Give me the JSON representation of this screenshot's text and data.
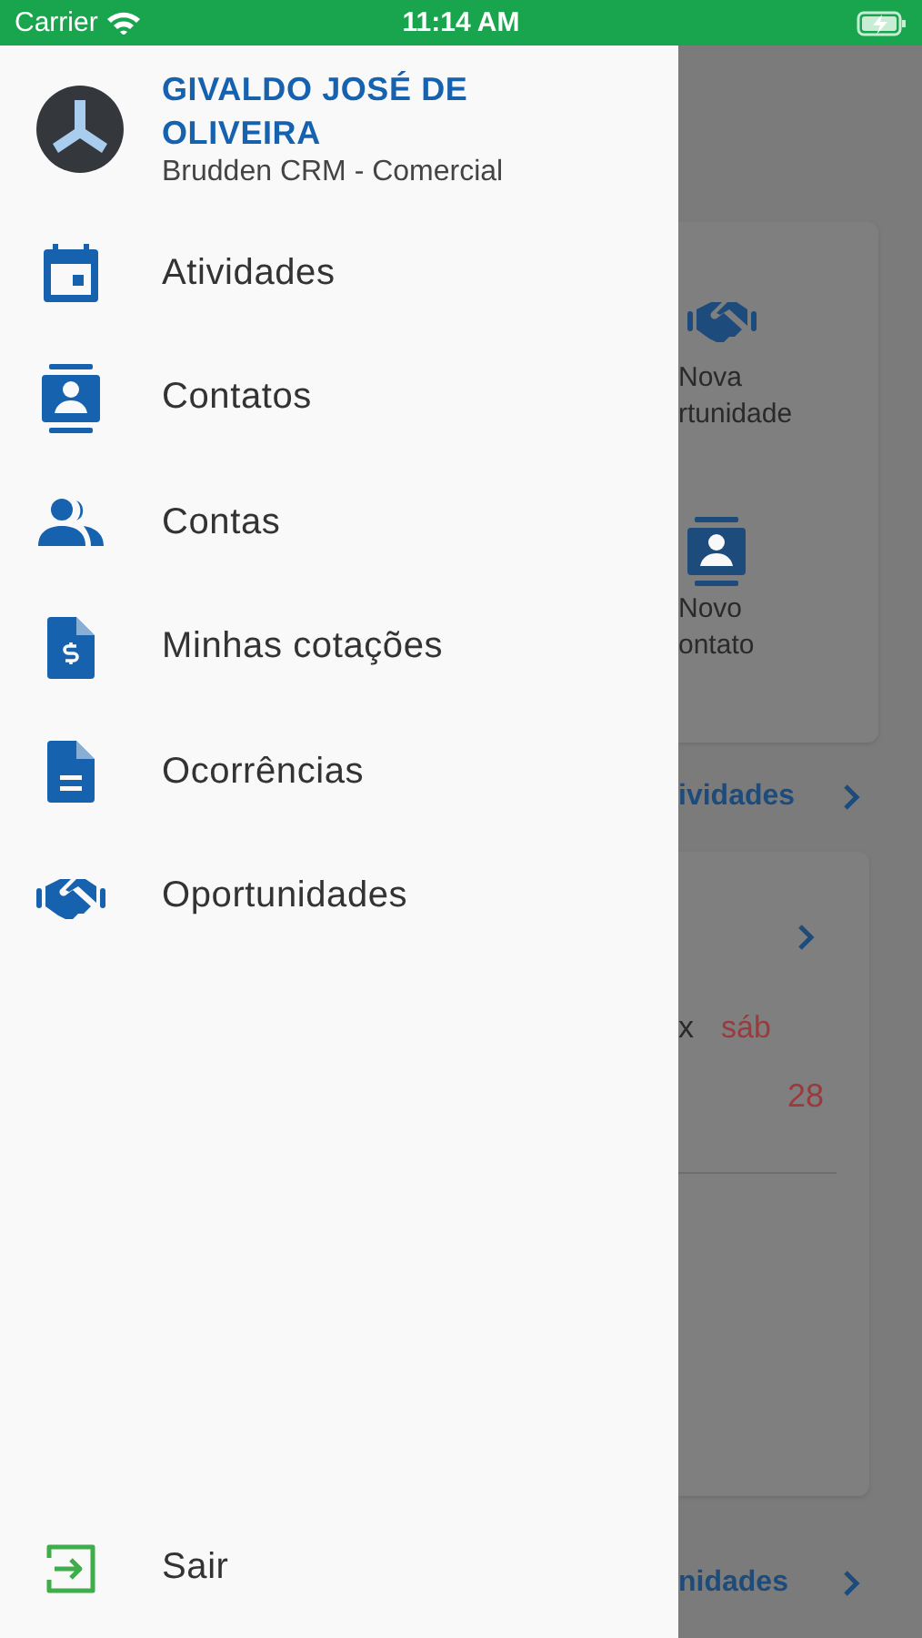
{
  "status_bar": {
    "carrier": "Carrier",
    "time": "11:14 AM"
  },
  "drawer": {
    "user": {
      "name": "GIVALDO JOSÉ DE OLIVEIRA",
      "subtitle": "Brudden CRM - Comercial"
    },
    "items": [
      {
        "label": "Atividades",
        "kind": "calendar"
      },
      {
        "label": "Contatos",
        "kind": "contact"
      },
      {
        "label": "Contas",
        "kind": "people"
      },
      {
        "label": "Minhas cotações",
        "kind": "invoice"
      },
      {
        "label": "Ocorrências",
        "kind": "document"
      },
      {
        "label": "Oportunidades",
        "kind": "handshake"
      }
    ],
    "logout": {
      "label": "Sair",
      "kind": "exit"
    }
  },
  "background": {
    "shortcuts": [
      {
        "lines": [
          "Nova",
          "rtunidade"
        ],
        "kind": "handshake"
      },
      {
        "lines": [
          "Novo",
          "ontato"
        ],
        "kind": "contact"
      }
    ],
    "section_links": [
      {
        "label": "ividades"
      },
      {
        "label": "nidades"
      }
    ],
    "calendar": {
      "weekdays": [
        {
          "label": "x",
          "weekend": false
        },
        {
          "label": "sáb",
          "weekend": true
        }
      ],
      "dates": [
        {
          "label": "28",
          "weekend": true
        }
      ]
    }
  }
}
